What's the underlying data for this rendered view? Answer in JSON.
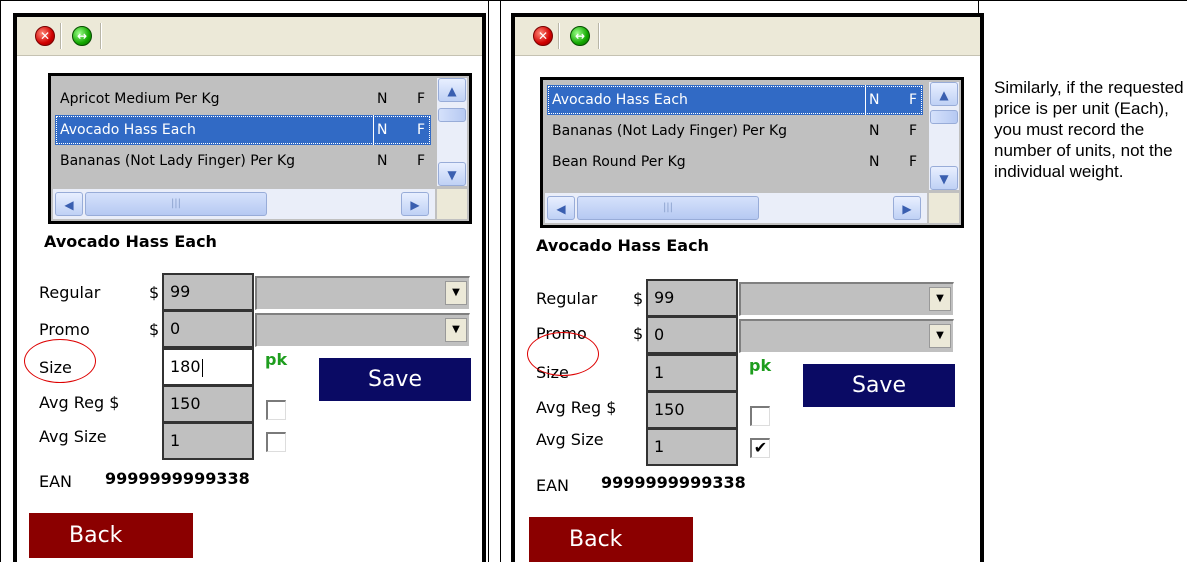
{
  "left_panel": {
    "list_rows": [
      {
        "name": "Apricot Medium Per Kg",
        "flag": "N",
        "flag2": "F",
        "selected": false
      },
      {
        "name": "Avocado Hass Each",
        "flag": "N",
        "flag2": "F",
        "selected": true
      },
      {
        "name": "Bananas (Not Lady Finger) Per Kg",
        "flag": "N",
        "flag2": "F",
        "selected": false
      }
    ],
    "selected_title": "Avocado Hass Each",
    "regular_label": "Regular",
    "regular_currency": "$",
    "regular_value": "99",
    "promo_label": "Promo",
    "promo_currency": "$",
    "promo_value": "0",
    "size_label": "Size",
    "size_value": "180",
    "unit_label": "pk",
    "save_label": "Save",
    "avg_reg_label": "Avg Reg $",
    "avg_reg_value": "150",
    "avg_size_label": "Avg Size",
    "avg_size_value": "1",
    "avg_reg_checked": false,
    "avg_size_checked": false,
    "ean_label": "EAN",
    "ean_value": "9999999999338",
    "back_label": "Back"
  },
  "right_panel": {
    "list_rows": [
      {
        "name": "Avocado Hass Each",
        "flag": "N",
        "flag2": "F",
        "selected": true
      },
      {
        "name": "Bananas (Not Lady Finger) Per Kg",
        "flag": "N",
        "flag2": "F",
        "selected": false
      },
      {
        "name": "Bean Round Per Kg",
        "flag": "N",
        "flag2": "F",
        "selected": false
      }
    ],
    "selected_title": "Avocado Hass Each",
    "regular_label": "Regular",
    "regular_currency": "$",
    "regular_value": "99",
    "promo_label": "Promo",
    "promo_currency": "$",
    "promo_value": "0",
    "size_label": "Size",
    "size_value": "1",
    "unit_label": "pk",
    "save_label": "Save",
    "avg_reg_label": "Avg Reg $",
    "avg_reg_value": "150",
    "avg_size_label": "Avg Size",
    "avg_size_value": "1",
    "avg_reg_checked": false,
    "avg_size_checked": true,
    "ean_label": "EAN",
    "ean_value": "9999999999338",
    "back_label": "Back"
  },
  "note": "Similarly, if the requested price is per unit (Each), you must record the number of units, not the individual weight.",
  "colors": {
    "selection": "#316ac5",
    "save_button": "#0a0a64",
    "back_button": "#8b0000",
    "pk_text": "#1e9d1e",
    "annotation_circle": "#dd0000"
  },
  "icons": {
    "close": "close-icon",
    "ok": "ok-icon",
    "scroll_up": "scroll-up-icon",
    "scroll_down": "scroll-down-icon",
    "scroll_left": "scroll-left-icon",
    "scroll_right": "scroll-right-icon",
    "dropdown": "dropdown-arrow-icon",
    "checkmark": "checkmark-icon"
  }
}
